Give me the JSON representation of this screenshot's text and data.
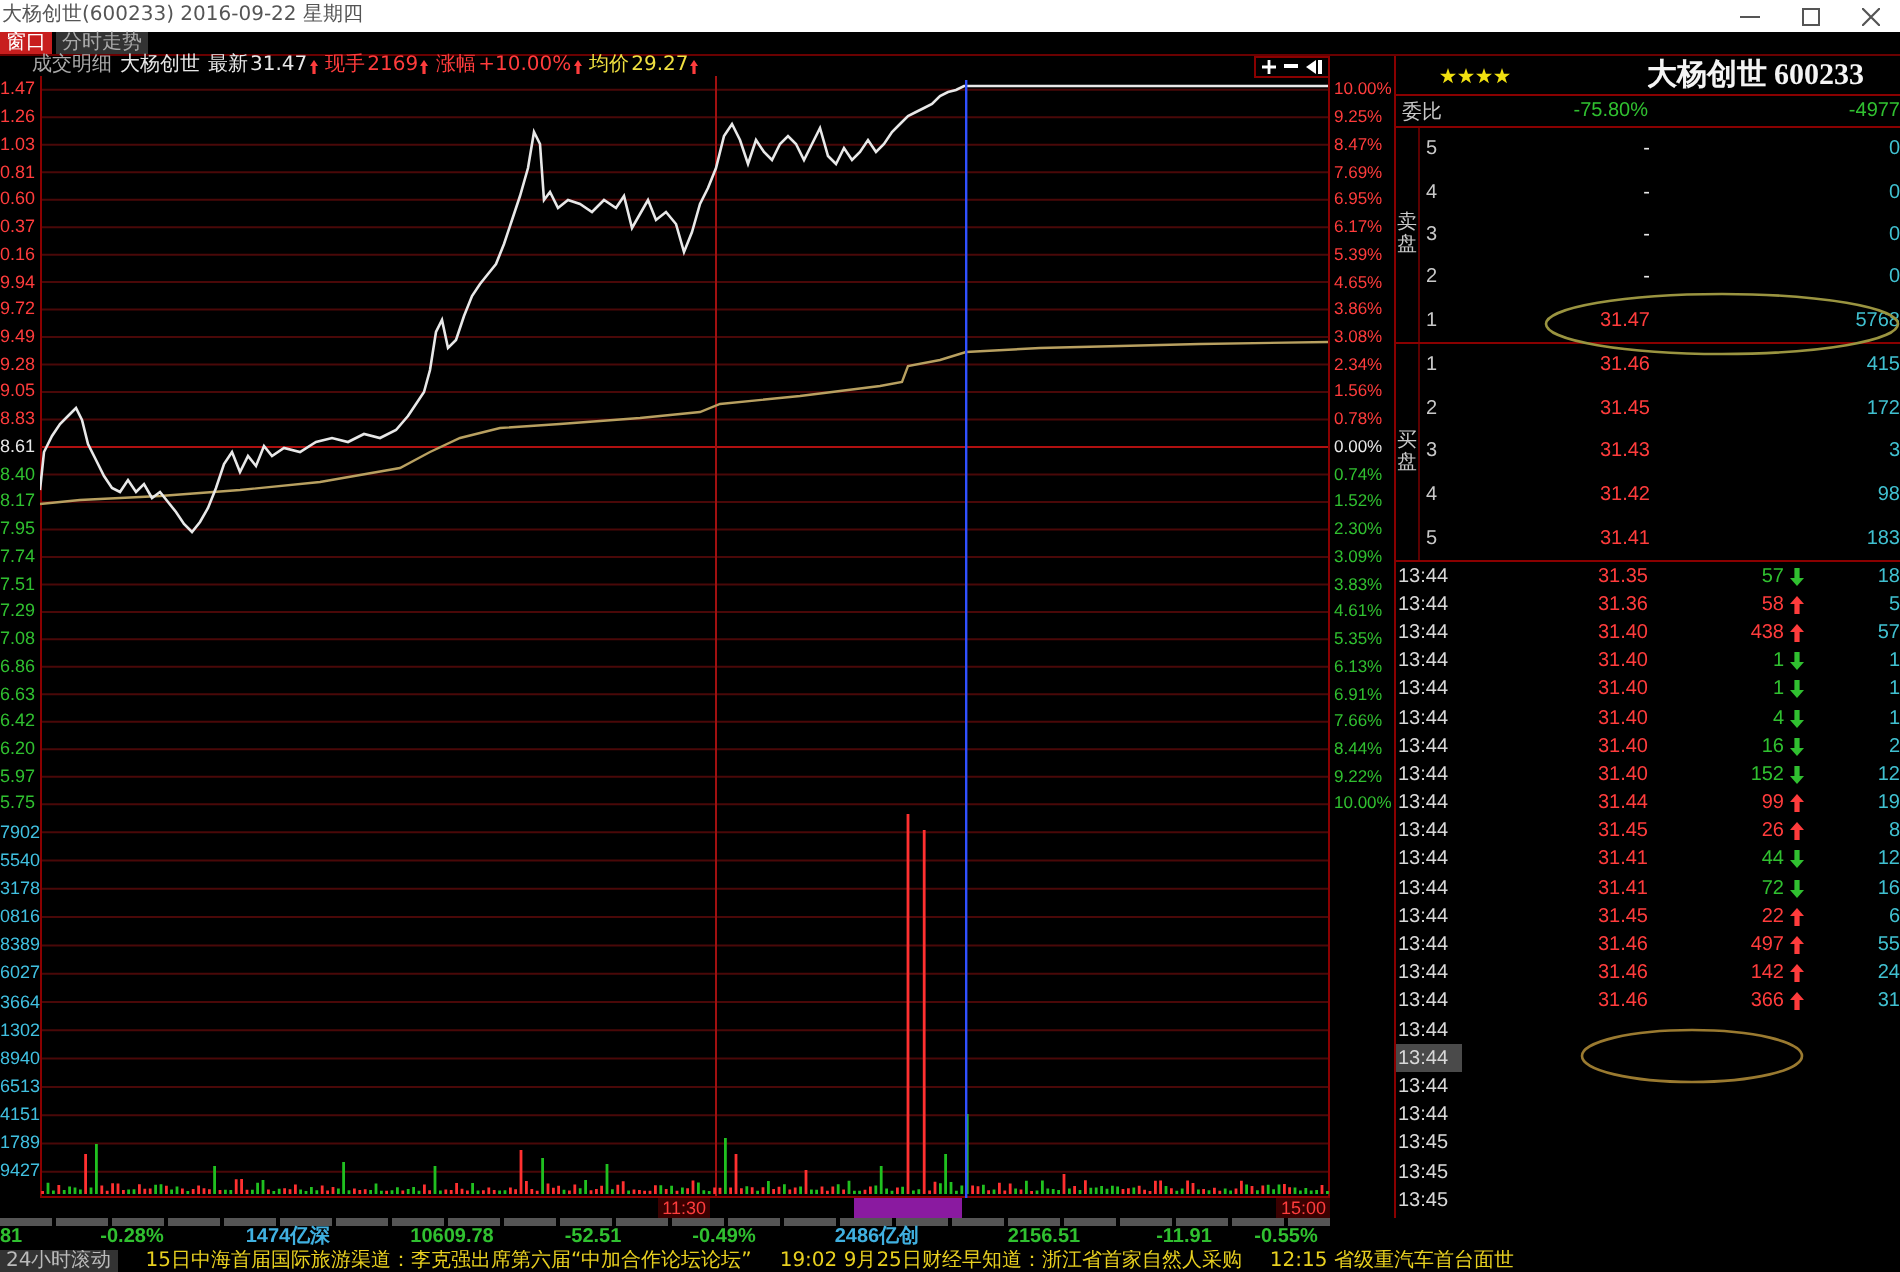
{
  "window": {
    "title": "大杨创世(600233) 2016-09-22 星期四"
  },
  "tabs": [
    {
      "label": "窗口",
      "selected": true
    },
    {
      "label": "分时走势",
      "selected": false
    }
  ],
  "chart": {
    "panel_label": "成交明细",
    "stock_name": "大杨创世",
    "fields": [
      {
        "label": "最新",
        "value": "31.47",
        "color": "#e8e8e8"
      },
      {
        "label": "现手",
        "value": "2169",
        "color": "#ff3c3c"
      },
      {
        "label": "涨幅",
        "value": "+10.00%",
        "color": "#ff3c3c"
      },
      {
        "label": "均价",
        "value": "29.27",
        "color": "#f0e040"
      }
    ],
    "price_labels": [
      {
        "text": "1.47",
        "color": "#ff3c3c"
      },
      {
        "text": "1.26",
        "color": "#ff3c3c"
      },
      {
        "text": "1.03",
        "color": "#ff3c3c"
      },
      {
        "text": "0.81",
        "color": "#ff3c3c"
      },
      {
        "text": "0.60",
        "color": "#ff3c3c"
      },
      {
        "text": "0.37",
        "color": "#ff3c3c"
      },
      {
        "text": "0.16",
        "color": "#ff3c3c"
      },
      {
        "text": "9.94",
        "color": "#ff3c3c"
      },
      {
        "text": "9.72",
        "color": "#ff3c3c"
      },
      {
        "text": "9.49",
        "color": "#ff3c3c"
      },
      {
        "text": "9.28",
        "color": "#ff3c3c"
      },
      {
        "text": "9.05",
        "color": "#ff3c3c"
      },
      {
        "text": "8.83",
        "color": "#ff3c3c"
      },
      {
        "text": "8.61",
        "color": "#e8e8e8"
      },
      {
        "text": "8.40",
        "color": "#30c030"
      },
      {
        "text": "8.17",
        "color": "#30c030"
      },
      {
        "text": "7.95",
        "color": "#30c030"
      },
      {
        "text": "7.74",
        "color": "#30c030"
      },
      {
        "text": "7.51",
        "color": "#30c030"
      },
      {
        "text": "7.29",
        "color": "#30c030"
      },
      {
        "text": "7.08",
        "color": "#30c030"
      },
      {
        "text": "6.86",
        "color": "#30c030"
      },
      {
        "text": "6.63",
        "color": "#30c030"
      },
      {
        "text": "6.42",
        "color": "#30c030"
      },
      {
        "text": "6.20",
        "color": "#30c030"
      },
      {
        "text": "5.97",
        "color": "#30c030"
      },
      {
        "text": "5.75",
        "color": "#30c030"
      }
    ],
    "percent_labels": [
      {
        "text": "10.00%",
        "color": "#ff3c3c"
      },
      {
        "text": "9.25%",
        "color": "#ff3c3c"
      },
      {
        "text": "8.47%",
        "color": "#ff3c3c"
      },
      {
        "text": "7.69%",
        "color": "#ff3c3c"
      },
      {
        "text": "6.95%",
        "color": "#ff3c3c"
      },
      {
        "text": "6.17%",
        "color": "#ff3c3c"
      },
      {
        "text": "5.39%",
        "color": "#ff3c3c"
      },
      {
        "text": "4.65%",
        "color": "#ff3c3c"
      },
      {
        "text": "3.86%",
        "color": "#ff3c3c"
      },
      {
        "text": "3.08%",
        "color": "#ff3c3c"
      },
      {
        "text": "2.34%",
        "color": "#ff3c3c"
      },
      {
        "text": "1.56%",
        "color": "#ff3c3c"
      },
      {
        "text": "0.78%",
        "color": "#ff3c3c"
      },
      {
        "text": "0.00%",
        "color": "#e8e8e8"
      },
      {
        "text": "0.74%",
        "color": "#30c030"
      },
      {
        "text": "1.52%",
        "color": "#30c030"
      },
      {
        "text": "2.30%",
        "color": "#30c030"
      },
      {
        "text": "3.09%",
        "color": "#30c030"
      },
      {
        "text": "3.83%",
        "color": "#30c030"
      },
      {
        "text": "4.61%",
        "color": "#30c030"
      },
      {
        "text": "5.35%",
        "color": "#30c030"
      },
      {
        "text": "6.13%",
        "color": "#30c030"
      },
      {
        "text": "6.91%",
        "color": "#30c030"
      },
      {
        "text": "7.66%",
        "color": "#30c030"
      },
      {
        "text": "8.44%",
        "color": "#30c030"
      },
      {
        "text": "9.22%",
        "color": "#30c030"
      },
      {
        "text": "10.00%",
        "color": "#30c030"
      }
    ],
    "volume_labels": [
      "7902",
      "5540",
      "3178",
      "0816",
      "8389",
      "6027",
      "3664",
      "1302",
      "8940",
      "6513",
      "4151",
      "1789",
      "9427"
    ],
    "time_labels": [
      "11:30",
      "15:00"
    ]
  },
  "quote_panel": {
    "stars": 4,
    "title": "大杨创世 600233",
    "order_ratio": {
      "label": "委比",
      "ratio": "-75.80%",
      "difference": "-4977"
    },
    "asks": {
      "label": "卖盘",
      "levels": [
        {
          "level": "5",
          "price": "-",
          "color": "#e8e8e8",
          "volume": "0"
        },
        {
          "level": "4",
          "price": "-",
          "color": "#e8e8e8",
          "volume": "0"
        },
        {
          "level": "3",
          "price": "-",
          "color": "#e8e8e8",
          "volume": "0"
        },
        {
          "level": "2",
          "price": "-",
          "color": "#e8e8e8",
          "volume": "0"
        },
        {
          "level": "1",
          "price": "31.47",
          "color": "#ff3c3c",
          "volume": "5768"
        }
      ]
    },
    "bids": {
      "label": "买盘",
      "levels": [
        {
          "level": "1",
          "price": "31.46",
          "color": "#ff3c3c",
          "volume": "415"
        },
        {
          "level": "2",
          "price": "31.45",
          "color": "#ff3c3c",
          "volume": "172"
        },
        {
          "level": "3",
          "price": "31.43",
          "color": "#ff3c3c",
          "volume": "3"
        },
        {
          "level": "4",
          "price": "31.42",
          "color": "#ff3c3c",
          "volume": "98"
        },
        {
          "level": "5",
          "price": "31.41",
          "color": "#ff3c3c",
          "volume": "183"
        }
      ]
    },
    "trades": [
      {
        "time": "13:44",
        "price": "31.35",
        "volume": "57",
        "rising": false,
        "count": "18",
        "selected": false
      },
      {
        "time": "13:44",
        "price": "31.36",
        "volume": "58",
        "rising": true,
        "count": "5",
        "selected": false
      },
      {
        "time": "13:44",
        "price": "31.40",
        "volume": "438",
        "rising": true,
        "count": "57",
        "selected": false
      },
      {
        "time": "13:44",
        "price": "31.40",
        "volume": "1",
        "rising": false,
        "count": "1",
        "selected": false
      },
      {
        "time": "13:44",
        "price": "31.40",
        "volume": "1",
        "rising": false,
        "count": "1",
        "selected": false
      },
      {
        "time": "13:44",
        "price": "31.40",
        "volume": "4",
        "rising": false,
        "count": "1",
        "selected": false
      },
      {
        "time": "13:44",
        "price": "31.40",
        "volume": "16",
        "rising": false,
        "count": "2",
        "selected": false
      },
      {
        "time": "13:44",
        "price": "31.40",
        "volume": "152",
        "rising": false,
        "count": "12",
        "selected": false
      },
      {
        "time": "13:44",
        "price": "31.44",
        "volume": "99",
        "rising": true,
        "count": "19",
        "selected": false
      },
      {
        "time": "13:44",
        "price": "31.45",
        "volume": "26",
        "rising": true,
        "count": "8",
        "selected": false
      },
      {
        "time": "13:44",
        "price": "31.41",
        "volume": "44",
        "rising": false,
        "count": "12",
        "selected": false
      },
      {
        "time": "13:44",
        "price": "31.41",
        "volume": "72",
        "rising": false,
        "count": "16",
        "selected": false
      },
      {
        "time": "13:44",
        "price": "31.45",
        "volume": "22",
        "rising": true,
        "count": "6",
        "selected": false
      },
      {
        "time": "13:44",
        "price": "31.46",
        "volume": "497",
        "rising": true,
        "count": "55",
        "selected": false
      },
      {
        "time": "13:44",
        "price": "31.46",
        "volume": "142",
        "rising": true,
        "count": "24",
        "selected": false
      },
      {
        "time": "13:44",
        "price": "31.46",
        "volume": "366",
        "rising": true,
        "count": "31",
        "selected": false
      },
      {
        "time": "13:44",
        "selected": false
      },
      {
        "time": "13:44",
        "selected": true
      },
      {
        "time": "13:44",
        "selected": false
      },
      {
        "time": "13:44",
        "selected": false
      },
      {
        "time": "13:45",
        "selected": false
      },
      {
        "time": "13:45",
        "selected": false
      },
      {
        "time": "13:45",
        "selected": false
      }
    ]
  },
  "index_bar": [
    {
      "text": "81",
      "kind": "quote"
    },
    {
      "text": "-0.28%",
      "kind": "quote"
    },
    {
      "text": "1474亿深",
      "kind": "turnover"
    },
    {
      "text": "10609.78",
      "kind": "quote"
    },
    {
      "text": "-52.51",
      "kind": "quote"
    },
    {
      "text": "-0.49%",
      "kind": "quote"
    },
    {
      "text": "2486亿创",
      "kind": "turnover"
    },
    {
      "text": "2156.51",
      "kind": "quote"
    },
    {
      "text": "-11.91",
      "kind": "quote"
    },
    {
      "text": "-0.55%",
      "kind": "quote"
    }
  ],
  "ticker": {
    "label": "24小时滚动",
    "items": [
      "15日中海首届国际旅游渠道：李克强出席第六届“中加合作论坛论坛”",
      "19:02 9月25日财经早知道：浙江省首家自然人采购",
      "12:15 省级重汽车首台面世"
    ]
  }
}
